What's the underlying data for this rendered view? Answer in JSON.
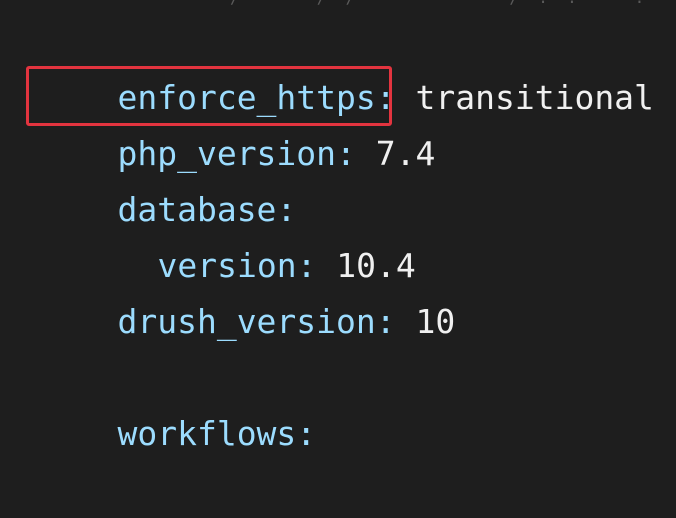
{
  "lines": [
    {
      "key": "enforce_https",
      "colon": ":",
      "value": " transitional"
    },
    {
      "key": "php_version",
      "colon": ":",
      "value": " 7.4"
    },
    {
      "key": "database",
      "colon": ":",
      "value": ""
    },
    {
      "key": "version",
      "colon": ":",
      "value": " 10.4"
    },
    {
      "key": "drush_version",
      "colon": ":",
      "value": " 10"
    },
    {
      "key": "workflows",
      "colon": ":",
      "value": ""
    }
  ],
  "highlight": {
    "color": "#e3343f"
  },
  "colors": {
    "background": "#1e1e1e",
    "key": "#9cdcfe",
    "value": "#f0f0f0"
  }
}
